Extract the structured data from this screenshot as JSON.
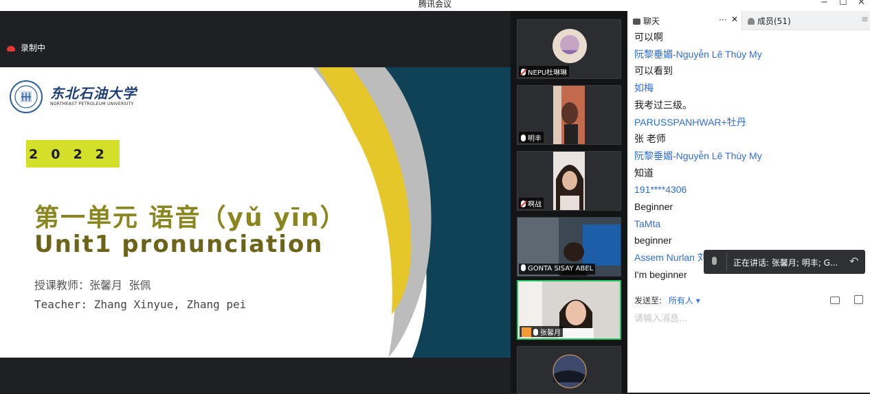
{
  "window": {
    "title": "腾讯会议",
    "minimize_glyph": "−",
    "maximize_glyph": "☐",
    "close_glyph": "✕"
  },
  "recording": {
    "label": "录制中"
  },
  "slide": {
    "university_cn": "东北石油大学",
    "university_en": "NORTHEAST PETROLEUM UNIVERSITY",
    "year": "2022",
    "unit_cn": "第一单元 语音（yǔ yīn）",
    "unit_en": "Unit1 pronunciation",
    "teacher_cn": "授课教师：张馨月 张佩",
    "teacher_en": "Teacher: Zhang Xinyue, Zhang pei",
    "colors": {
      "navy": "#0f4256",
      "yellow": "#e6c72a",
      "gray": "#b9b9b9",
      "year_bg": "#d4df2a",
      "title": "#8a861f"
    }
  },
  "participants": [
    {
      "name": "NEPU杜琳琳",
      "mic": "muted",
      "tile": "avatar"
    },
    {
      "name": "明丰",
      "mic": "on",
      "tile": "video"
    },
    {
      "name": "啊战",
      "mic": "muted",
      "tile": "video"
    },
    {
      "name": "GONTA SISAY ABEL",
      "mic": "on",
      "tile": "video"
    },
    {
      "name": "张馨月",
      "mic": "on",
      "tile": "video",
      "speaking": true,
      "host_icon": "person-icon"
    },
    {
      "name": "",
      "mic": "on",
      "tile": "avatar"
    }
  ],
  "chat": {
    "tab_chat": "聊天",
    "tab_more": "···",
    "tab_close": "✕",
    "tab_members": "成员(51)",
    "messages": [
      {
        "kind": "text",
        "value": "可以啊"
      },
      {
        "kind": "sender",
        "value": "阮黎垂媚-Nguyễn Lê Thùy My"
      },
      {
        "kind": "text",
        "value": "可以看到"
      },
      {
        "kind": "sender",
        "value": "如梅"
      },
      {
        "kind": "text",
        "value": "我考过三级。"
      },
      {
        "kind": "sender",
        "value": "PARUSSPANHWAR+牡丹"
      },
      {
        "kind": "text",
        "value": "张 老师"
      },
      {
        "kind": "sender",
        "value": "阮黎垂媚-Nguyễn Lê Thùy My"
      },
      {
        "kind": "text",
        "value": "知道"
      },
      {
        "kind": "sender",
        "value": "191****4306"
      },
      {
        "kind": "text",
        "value": "Beginner"
      },
      {
        "kind": "sender",
        "value": "TaMta"
      },
      {
        "kind": "text",
        "value": "beginner"
      },
      {
        "kind": "sender",
        "value": "Assem Nurlan 刘然"
      },
      {
        "kind": "text",
        "value": "I'm beginner"
      }
    ],
    "speaking_toast": "正在讲话: 张馨月; 明丰; G...",
    "send_to_label": "发送至:",
    "send_to_value": "所有人",
    "input_placeholder": "请输入消息..."
  }
}
